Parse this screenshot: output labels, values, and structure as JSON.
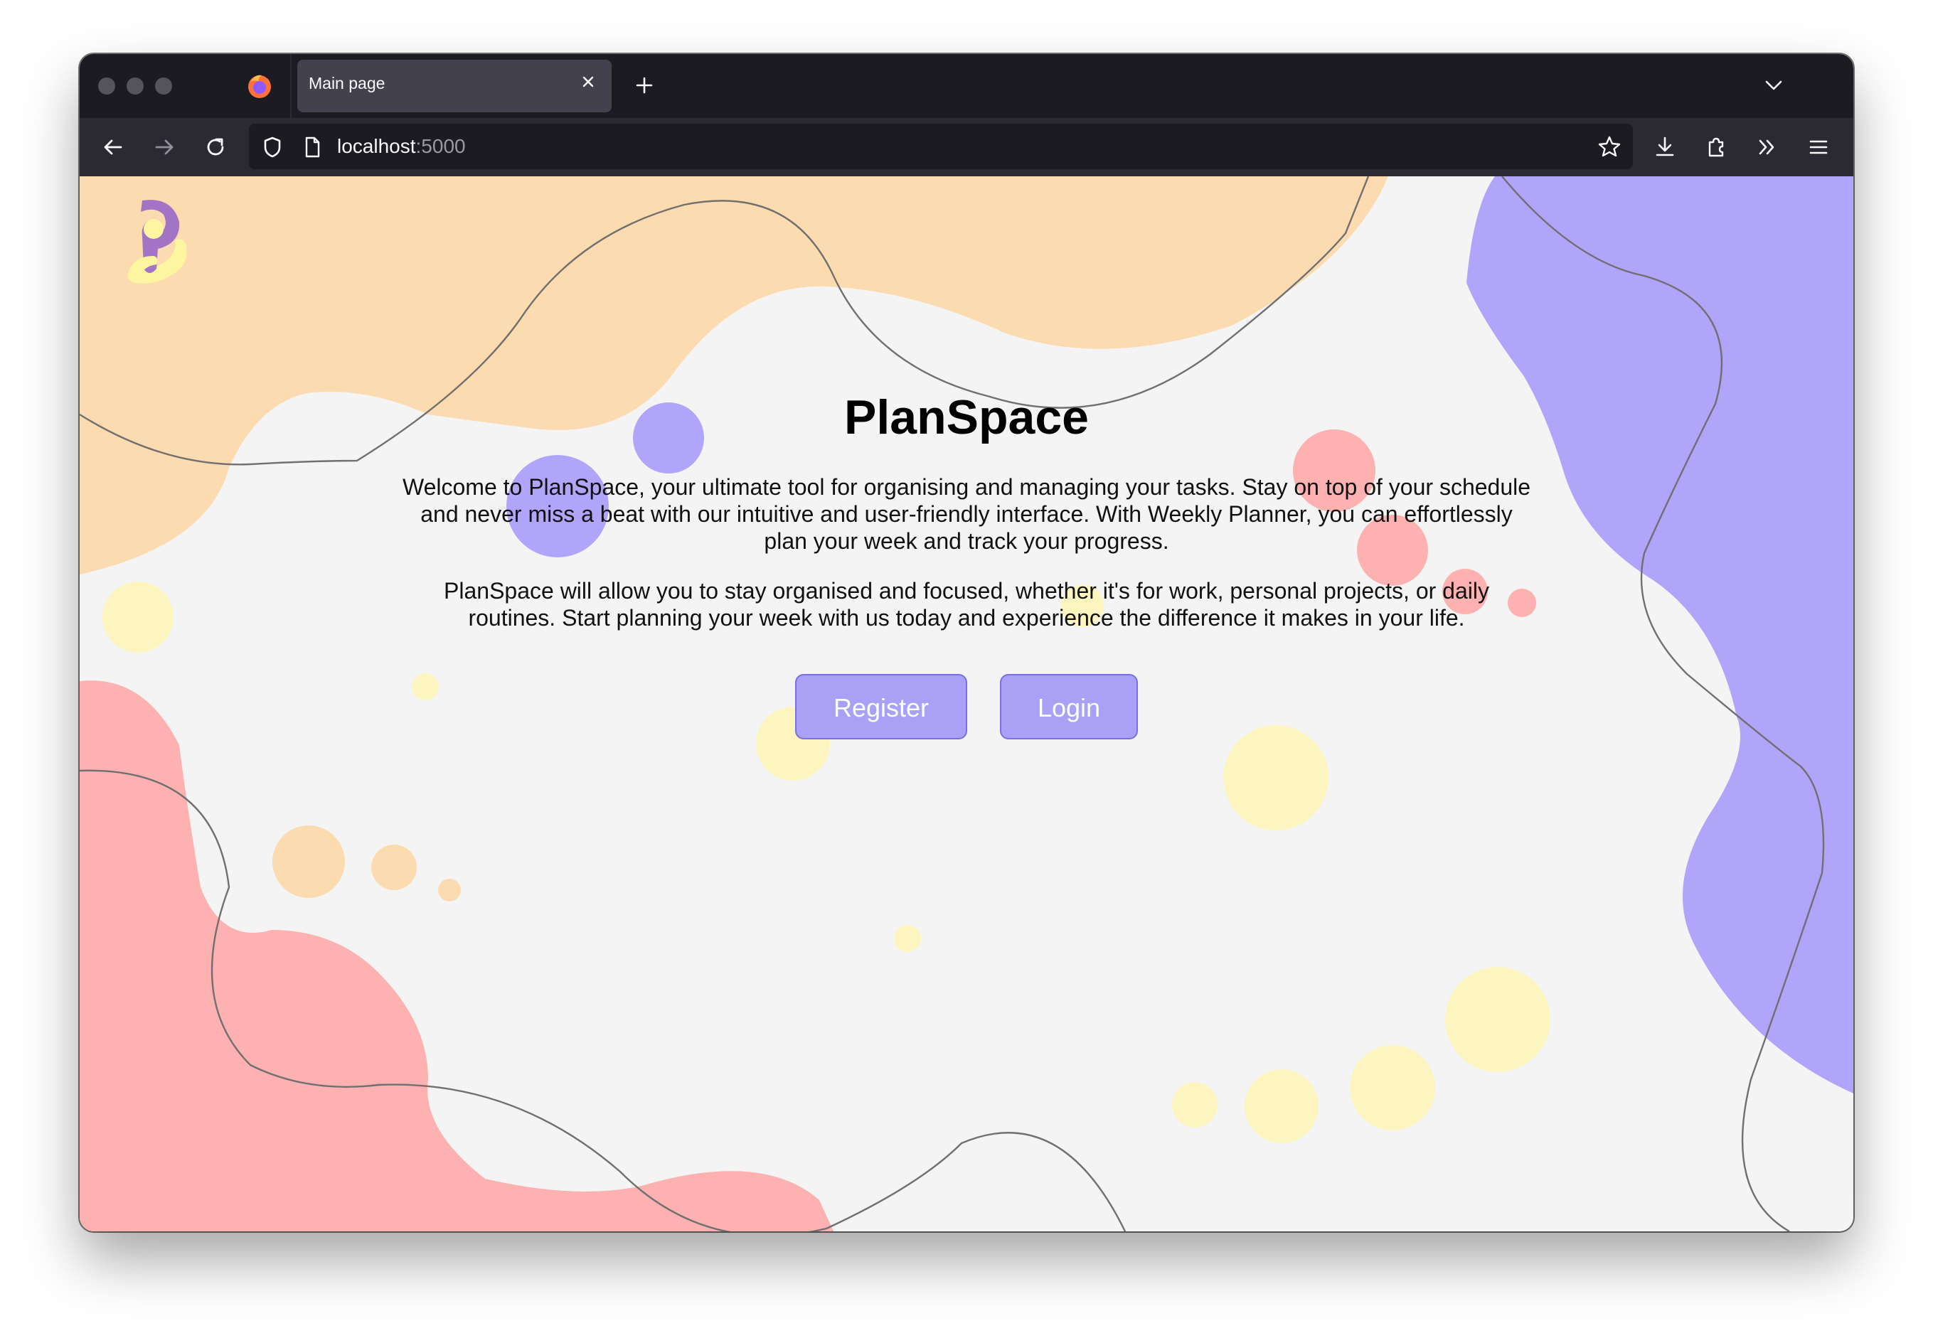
{
  "browser": {
    "tab_title": "Main page",
    "url_host": "localhost",
    "url_port": ":5000"
  },
  "page": {
    "title": "PlanSpace",
    "paragraph_1": "Welcome to PlanSpace, your ultimate tool for organising and managing your tasks. Stay on top of your schedule and never miss a beat with our intuitive and user-friendly interface. With Weekly Planner, you can effortlessly plan your week and track your progress.",
    "paragraph_2": "PlanSpace will allow you to stay organised and focused, whether it's for work, personal projects, or daily routines. Start planning your week with us today and experience the difference it makes in your life.",
    "register_label": "Register",
    "login_label": "Login"
  },
  "colors": {
    "accent": "#aaa1f6",
    "peach": "#fddbb0",
    "pink": "#feb1b1",
    "lavender": "#b1a4fb",
    "yellow": "#fdf5c0"
  }
}
